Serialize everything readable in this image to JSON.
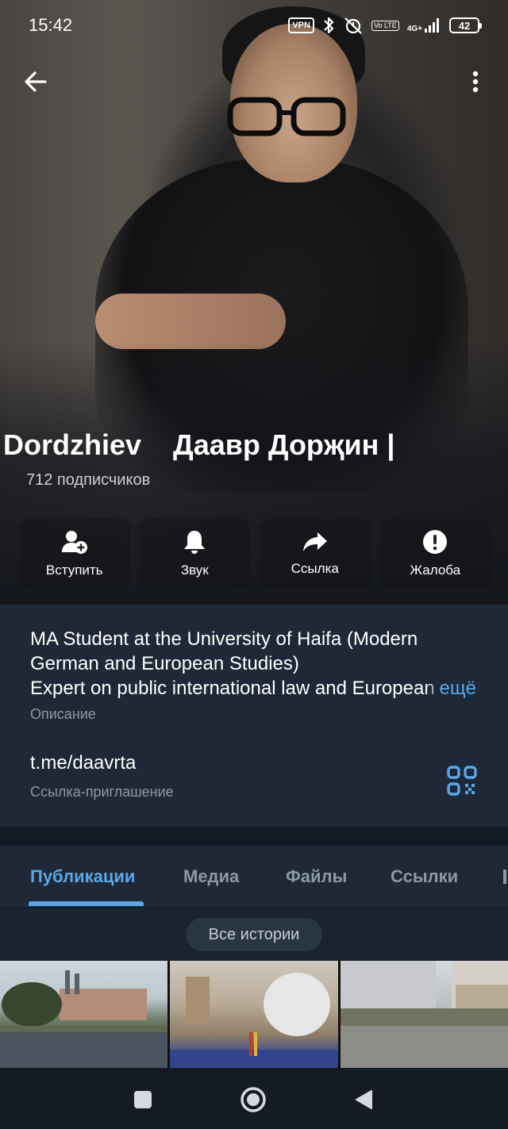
{
  "status_bar": {
    "time": "15:42",
    "vpn": "VPN",
    "volte": "Vo LTE",
    "network": "4G+",
    "battery": "42"
  },
  "nav": {
    "back_icon": "arrow-left-icon",
    "menu_icon": "more-vertical-icon"
  },
  "profile": {
    "name": "r Dordzhiev    Даавр Дорҗин |",
    "subscribers": "712 подписчиков"
  },
  "actions": [
    {
      "label": "Вступить",
      "icon": "add-user-icon"
    },
    {
      "label": "Звук",
      "icon": "bell-icon"
    },
    {
      "label": "Ссылка",
      "icon": "share-arrow-icon"
    },
    {
      "label": "Жалоба",
      "icon": "alert-icon"
    }
  ],
  "info": {
    "description_lines": [
      "MA Student at the University of Haifa (Modern",
      "German and European Studies)",
      "Expert on public international law and European"
    ],
    "more_label": "ещё",
    "description_label": "Описание",
    "invite_link": "t.me/daavrta",
    "invite_label": "Ссылка-приглашение"
  },
  "tabs": [
    {
      "label": "Публикации",
      "active": true
    },
    {
      "label": "Медиа",
      "active": false
    },
    {
      "label": "Файлы",
      "active": false
    },
    {
      "label": "Ссылки",
      "active": false
    }
  ],
  "stories_button": "Все истории",
  "colors": {
    "accent": "#5aa7e8",
    "panel": "#1e2836",
    "muted_text": "#8d98a6"
  }
}
